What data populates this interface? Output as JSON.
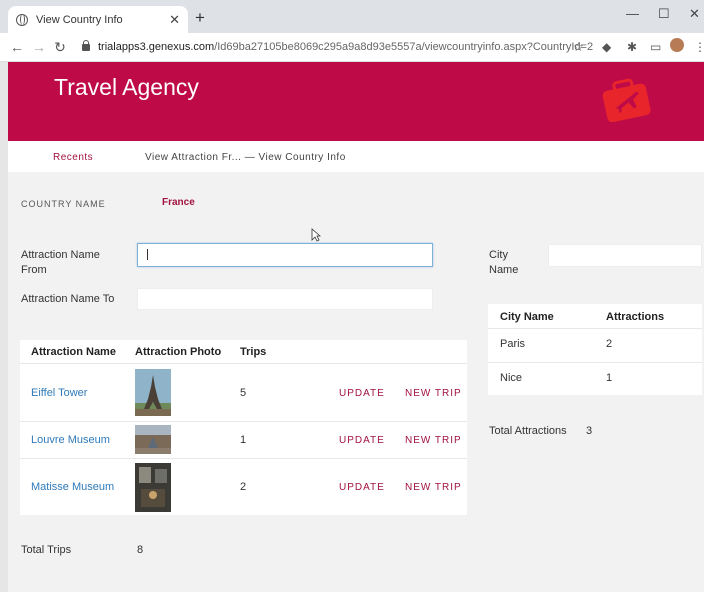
{
  "browser": {
    "tab_title": "View Country Info",
    "url_host": "trialapps3.genexus.com",
    "url_path": "/Id69ba27105be8069c295a9a8d93e5557a/viewcountryinfo.aspx?CountryId=2"
  },
  "header": {
    "title": "Travel Agency"
  },
  "nav": {
    "recents": "Recents",
    "breadcrumb": "View Attraction Fr... — View Country Info"
  },
  "form": {
    "country_label": "COUNTRY NAME",
    "country_value": "France",
    "from_label_1": "Attraction Name",
    "from_label_2": "From",
    "from_value": "",
    "to_label": "Attraction Name To",
    "to_value": "",
    "city_label_1": "City",
    "city_label_2": "Name",
    "city_value": ""
  },
  "attractions": {
    "headers": [
      "Attraction Name",
      "Attraction Photo",
      "Trips"
    ],
    "rows": [
      {
        "name": "Eiffel Tower",
        "trips": "5",
        "update": "UPDATE",
        "new_trip": "NEW TRIP"
      },
      {
        "name": "Louvre Museum",
        "trips": "1",
        "update": "UPDATE",
        "new_trip": "NEW TRIP"
      },
      {
        "name": "Matisse Museum",
        "trips": "2",
        "update": "UPDATE",
        "new_trip": "NEW TRIP"
      }
    ],
    "total_label": "Total Trips",
    "total_value": "8"
  },
  "cities": {
    "headers": [
      "City Name",
      "Attractions"
    ],
    "rows": [
      {
        "city": "Paris",
        "count": "2"
      },
      {
        "city": "Nice",
        "count": "1"
      }
    ],
    "total_label": "Total Attractions",
    "total_value": "3"
  },
  "colors": {
    "brand": "#bf0a48",
    "link": "#2f7ab9",
    "action": "#a1133f"
  }
}
